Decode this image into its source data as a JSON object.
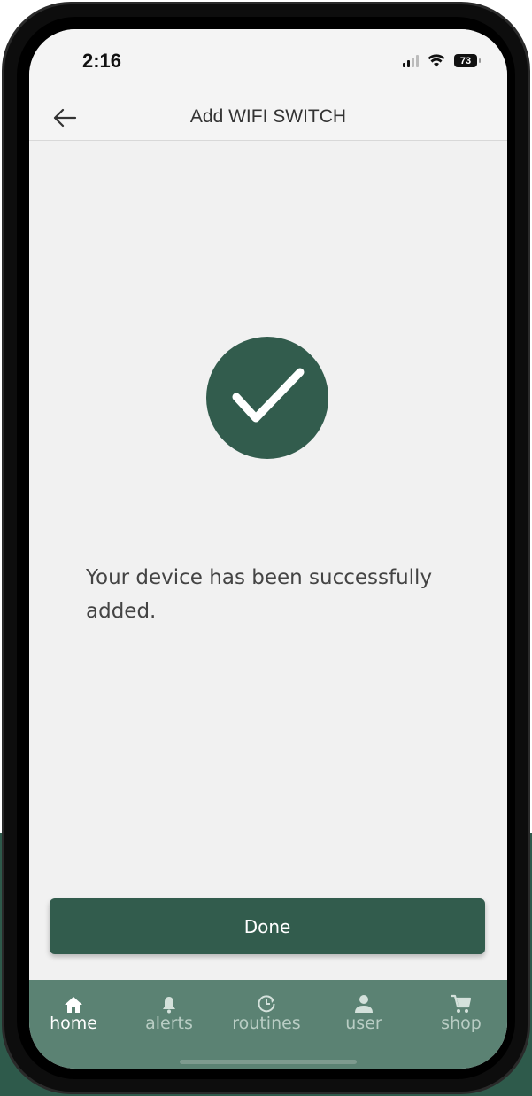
{
  "status_bar": {
    "time": "2:16",
    "battery": "73"
  },
  "header": {
    "title": "Add WIFI SWITCH"
  },
  "main": {
    "message": "Your device has been successfully added.",
    "done_label": "Done"
  },
  "tab_bar": {
    "items": [
      {
        "label": "home",
        "icon": "home-icon",
        "active": true
      },
      {
        "label": "alerts",
        "icon": "bell-icon",
        "active": false
      },
      {
        "label": "routines",
        "icon": "clock-icon",
        "active": false
      },
      {
        "label": "user",
        "icon": "user-icon",
        "active": false
      },
      {
        "label": "shop",
        "icon": "cart-icon",
        "active": false
      }
    ]
  },
  "colors": {
    "brand_green": "#325c4d",
    "tab_bar_bg": "#5b8273",
    "screen_bg": "#f1f1f1"
  }
}
